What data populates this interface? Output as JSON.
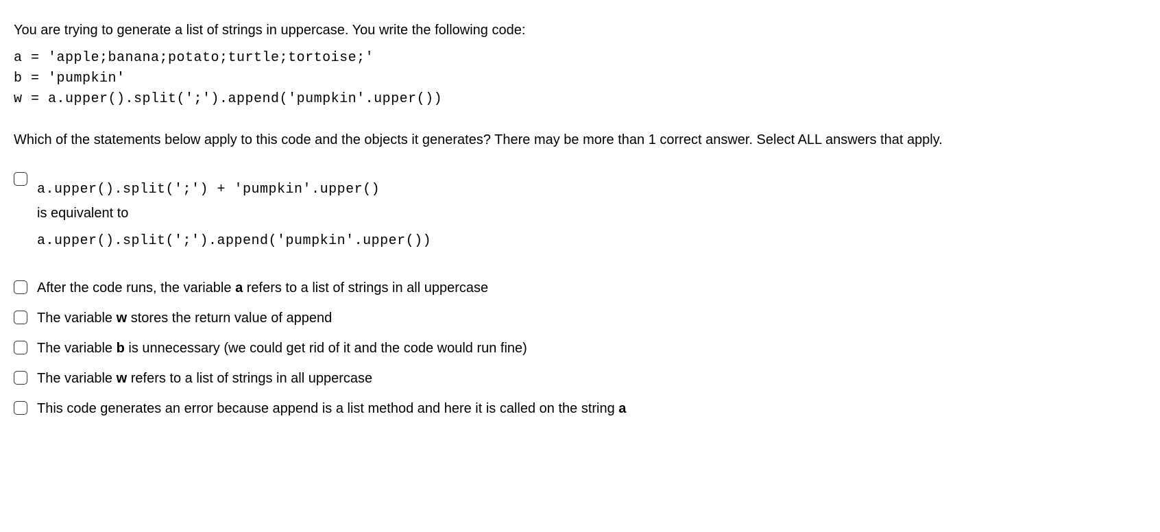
{
  "intro": "You are trying to generate a list of strings in uppercase. You write the following code:",
  "code_line1": "a = 'apple;banana;potato;turtle;tortoise;'",
  "code_line2": "b = 'pumpkin'",
  "code_line3": "w = a.upper().split(';').append('pumpkin'.upper())",
  "question": "Which of the statements below apply to this code and the objects it generates? There may be more than 1 correct answer. Select ALL answers that apply.",
  "options": {
    "opt1_code1": "a.upper().split(';') + 'pumpkin'.upper()",
    "opt1_text1": "is equivalent to",
    "opt1_code2": "a.upper().split(';').append('pumpkin'.upper())",
    "opt2_pre": "After the code runs, the variable ",
    "opt2_bold": "a",
    "opt2_post": " refers to a list of strings in all uppercase",
    "opt3_pre": "The variable ",
    "opt3_bold": "w",
    "opt3_post": " stores the return value of append",
    "opt4_pre": "The variable ",
    "opt4_bold": "b",
    "opt4_post": " is unnecessary (we could get rid of it and the code would run fine)",
    "opt5_pre": "The variable ",
    "opt5_bold": "w",
    "opt5_post": " refers to a list of strings in all uppercase",
    "opt6_pre": "This code generates an error because append is a list method and here it is called on the string ",
    "opt6_bold": "a"
  }
}
